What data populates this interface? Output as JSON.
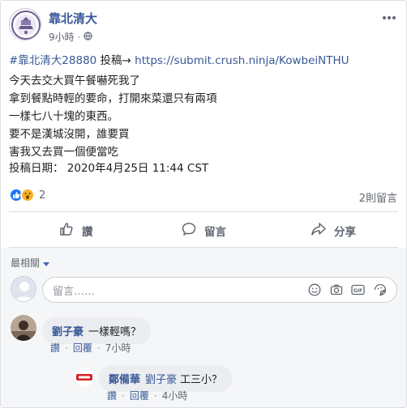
{
  "page": {
    "name": "靠北清大",
    "time": "9小時",
    "privacy_icon": "globe-icon",
    "more_icon": "more-horizontal-icon"
  },
  "post": {
    "hashtag": "#靠北清大28880",
    "link_prefix": " 投稿→ ",
    "url": "https://submit.crush.ninja/KowbeiNTHU",
    "lines": [
      "今天去交大買午餐嚇死我了",
      "拿到餐點時輕的要命，打開來菜還只有兩項",
      "一樣七八十塊的東西。",
      "要不是漢城沒開，誰要買",
      "害我又去買一個便當吃"
    ],
    "date_line": "投稿日期： 2020年4月25日 11:44 CST"
  },
  "reactions": {
    "icons": [
      "like-reaction-icon",
      "wow-reaction-icon"
    ],
    "count": "2",
    "comments_count": "2則留言"
  },
  "actions": {
    "like_label": "讚",
    "comment_label": "留言",
    "share_label": "分享"
  },
  "comments_section": {
    "sort_label": "最相關",
    "composer_placeholder": "留言……",
    "composer_icons": [
      "emoji-icon",
      "camera-icon",
      "gif-icon",
      "sticker-icon"
    ]
  },
  "comments": [
    {
      "author": "劉子豪",
      "text": "一樣輕嗎？",
      "like": "讚",
      "reply": "回覆",
      "time": "7小時"
    },
    {
      "author": "鄭備華",
      "mention": "劉子豪",
      "text": "工三小？",
      "like": "讚",
      "reply": "回覆",
      "time": "4小時"
    }
  ],
  "colors": {
    "link": "#385898",
    "muted": "#606770",
    "like_blue": "#1877f2",
    "wow_yellow": "#f7b125",
    "divider": "#dadde1"
  }
}
